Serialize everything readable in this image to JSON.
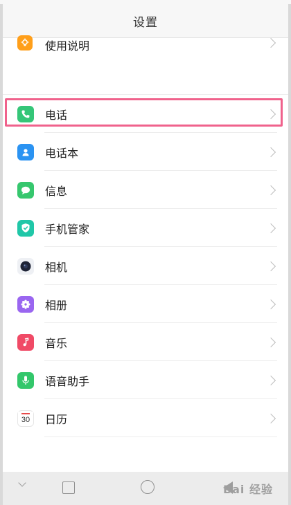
{
  "header": {
    "title": "设置"
  },
  "settings": {
    "items": [
      {
        "label": "使用说明",
        "icon": "lightbulb-icon",
        "color": "#ff9f1a"
      },
      {
        "label": "电话",
        "icon": "phone-icon",
        "color": "#35c678"
      },
      {
        "label": "电话本",
        "icon": "contacts-icon",
        "color": "#2b93f2"
      },
      {
        "label": "信息",
        "icon": "message-icon",
        "color": "#36c76e"
      },
      {
        "label": "手机管家",
        "icon": "shield-check-icon",
        "color": "#20c7a8"
      },
      {
        "label": "相机",
        "icon": "camera-icon",
        "color": "#1f2436"
      },
      {
        "label": "相册",
        "icon": "gallery-icon",
        "color": "#9a66f0"
      },
      {
        "label": "音乐",
        "icon": "music-icon",
        "color": "#f04a66"
      },
      {
        "label": "语音助手",
        "icon": "microphone-icon",
        "color": "#33c76b"
      },
      {
        "label": "日历",
        "icon": "calendar-icon",
        "color": "#ffffff",
        "day": "30"
      }
    ]
  },
  "highlight": {
    "color": "#f0628c"
  },
  "watermark": {
    "text": "Bai 经验"
  }
}
